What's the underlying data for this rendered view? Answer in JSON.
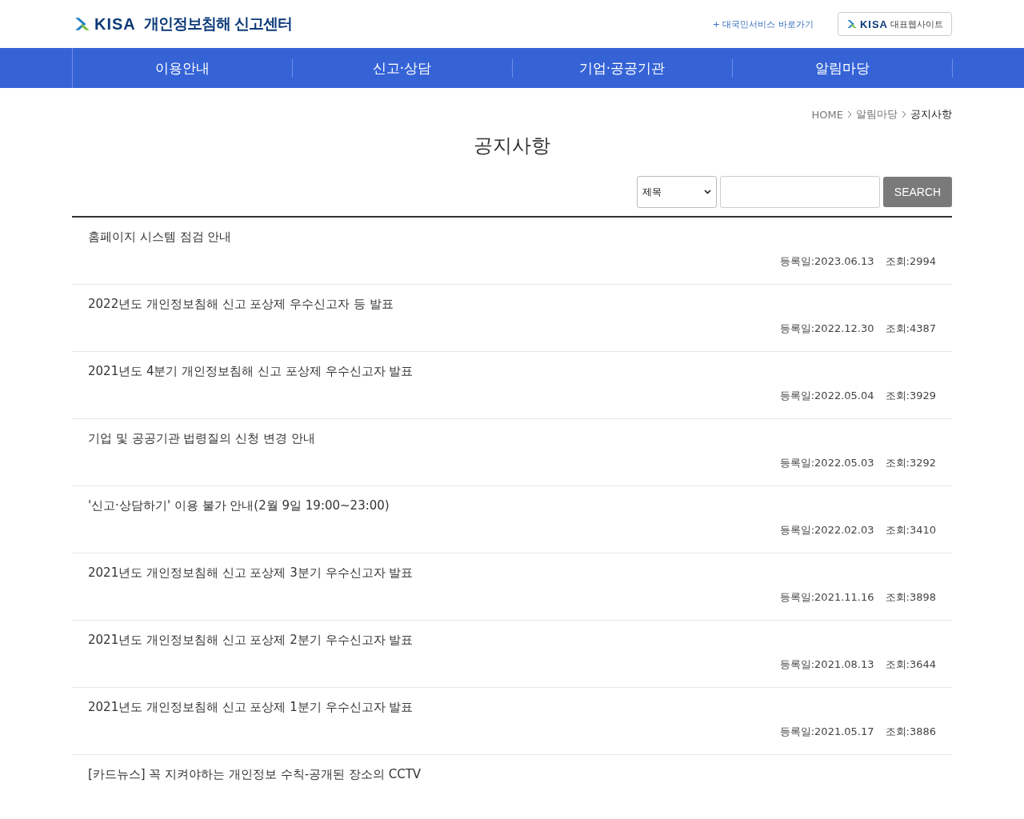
{
  "header": {
    "logo_text": "KISA",
    "site_title": "개인정보침해 신고센터",
    "service_link": "+ 대국민서비스 바로가기",
    "main_site_button": {
      "logo_text": "KISA",
      "label": "대표웹사이트"
    }
  },
  "nav": [
    {
      "label": "이용안내"
    },
    {
      "label": "신고·상담"
    },
    {
      "label": "기업·공공기관"
    },
    {
      "label": "알림마당"
    }
  ],
  "breadcrumb": [
    {
      "label": "HOME"
    },
    {
      "label": "알림마당"
    },
    {
      "label": "공지사항"
    }
  ],
  "page_title": "공지사항",
  "search": {
    "select_value": "제목",
    "button": "SEARCH"
  },
  "notices": [
    {
      "title": "홈페이지 시스템 점검 안내",
      "date": "등록일:2023.06.13",
      "views": "조회:2994"
    },
    {
      "title": "2022년도 개인정보침해 신고 포상제 우수신고자 등 발표",
      "date": "등록일:2022.12.30",
      "views": "조회:4387"
    },
    {
      "title": "2021년도 4분기 개인정보침해 신고 포상제 우수신고자 발표",
      "date": "등록일:2022.05.04",
      "views": "조회:3929"
    },
    {
      "title": "기업 및 공공기관 법령질의 신청 변경 안내",
      "date": "등록일:2022.05.03",
      "views": "조회:3292"
    },
    {
      "title": "'신고·상담하기' 이용 불가 안내(2월 9일 19:00~23:00)",
      "date": "등록일:2022.02.03",
      "views": "조회:3410"
    },
    {
      "title": "2021년도 개인정보침해 신고 포상제 3분기 우수신고자 발표",
      "date": "등록일:2021.11.16",
      "views": "조회:3898"
    },
    {
      "title": "2021년도 개인정보침해 신고 포상제 2분기 우수신고자 발표",
      "date": "등록일:2021.08.13",
      "views": "조회:3644"
    },
    {
      "title": "2021년도 개인정보침해 신고 포상제 1분기 우수신고자 발표",
      "date": "등록일:2021.05.17",
      "views": "조회:3886"
    },
    {
      "title": "[카드뉴스] 꼭 지켜야하는 개인정보 수칙-공개된 장소의 CCTV"
    }
  ]
}
